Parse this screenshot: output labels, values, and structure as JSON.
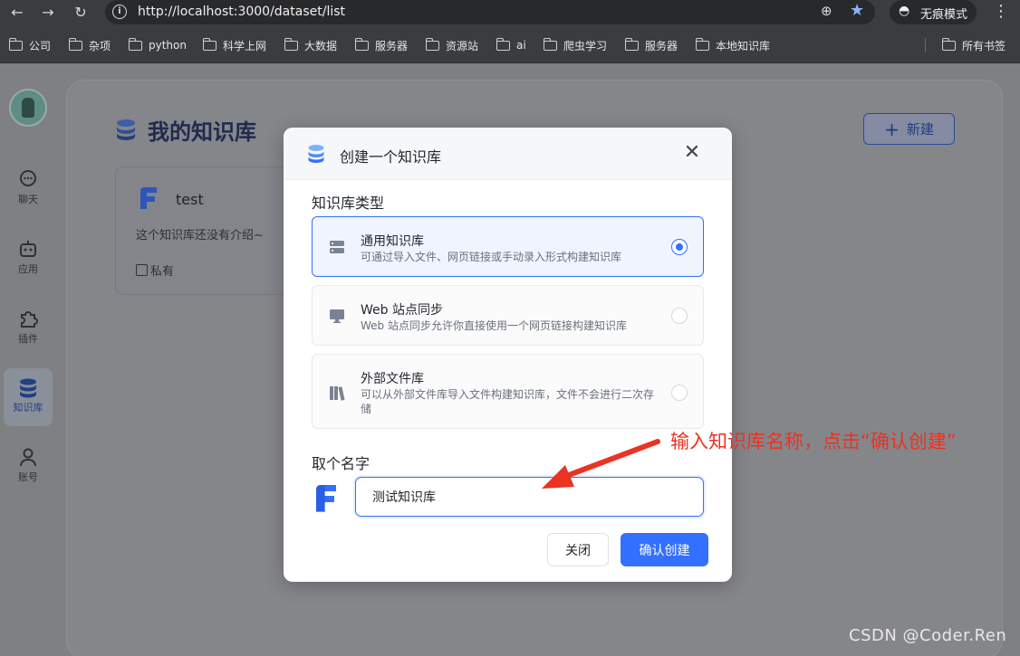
{
  "browser": {
    "url": "http://localhost:3000/dataset/list",
    "incognito_label": "无痕模式",
    "bookmarks": [
      "公司",
      "杂项",
      "python",
      "科学上网",
      "大数据",
      "服务器",
      "资源站",
      "ai",
      "爬虫学习",
      "服务器",
      "本地知识库"
    ],
    "all_bookmarks": "所有书签"
  },
  "sidebar": {
    "items": [
      {
        "label": "聊天",
        "icon": "chat-bubble-icon"
      },
      {
        "label": "应用",
        "icon": "robot-icon"
      },
      {
        "label": "插件",
        "icon": "puzzle-icon"
      },
      {
        "label": "知识库",
        "icon": "database-icon",
        "active": true
      },
      {
        "label": "账号",
        "icon": "user-icon"
      }
    ]
  },
  "main": {
    "title": "我的知识库",
    "new_button": "新建",
    "dataset_card": {
      "name": "test",
      "description": "这个知识库还没有介绍~",
      "visibility": "私有"
    }
  },
  "modal": {
    "title": "创建一个知识库",
    "type_label": "知识库类型",
    "options": [
      {
        "title": "通用知识库",
        "desc": "可通过导入文件、网页链接或手动录入形式构建知识库",
        "selected": true
      },
      {
        "title": "Web 站点同步",
        "desc": "Web 站点同步允许你直接使用一个网页链接构建知识库",
        "selected": false
      },
      {
        "title": "外部文件库",
        "desc": "可以从外部文件库导入文件构建知识库，文件不会进行二次存储",
        "selected": false
      }
    ],
    "name_label": "取个名字",
    "name_value": "测试知识库",
    "close_button": "关闭",
    "confirm_button": "确认创建"
  },
  "annotation": {
    "text": "输入知识库名称，点击“确认创建”",
    "color": "#ea3323"
  },
  "watermark": "CSDN @Coder.Ren",
  "colors": {
    "primary": "#3370ff",
    "annotation": "#ea3323"
  }
}
